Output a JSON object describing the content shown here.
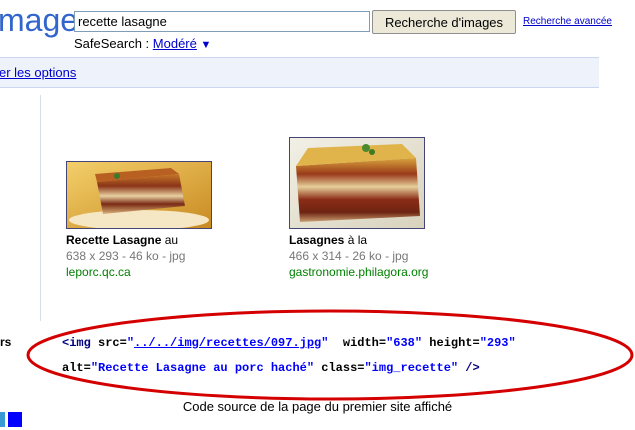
{
  "logo": {
    "text": "mages"
  },
  "search": {
    "value": "recette lasagne",
    "button_label": "Recherche d'images",
    "advanced_label": "Recherche avancée"
  },
  "safesearch": {
    "label": "SafeSearch :",
    "value": "Modéré",
    "arrow": "▼"
  },
  "options_link": "er les options",
  "results": [
    {
      "title_bold": "Recette Lasagne",
      "title_rest": " au",
      "meta": "638 x 293 - 46 ko - jpg",
      "url": "leporc.qc.ca"
    },
    {
      "title_bold": "Lasagnes",
      "title_rest": " à la",
      "meta": "466 x 314 - 26 ko - jpg",
      "url": "gastronomie.philagora.org"
    }
  ],
  "left_fragment": "rs",
  "code": {
    "lt": "<",
    "tag": "img",
    "src_attr": " src=",
    "src_q1": "\"",
    "src_val": "../../img/recettes/097.jpg",
    "src_q2": "\"",
    "width_attr": "  width=",
    "width_val": "\"638\"",
    "height_attr": " height=",
    "height_val": "\"293\"",
    "alt_attr": "alt=",
    "alt_val": "\"Recette Lasagne au porc haché\"",
    "class_attr": " class=",
    "class_val": "\"img_recette\"",
    "close": " />"
  },
  "caption": "Code source de la page du premier site affiché",
  "colors": {
    "link": "#0000cc",
    "url_green": "#008000",
    "ellipse_red": "#d40000",
    "options_bg": "#eef3fb"
  }
}
